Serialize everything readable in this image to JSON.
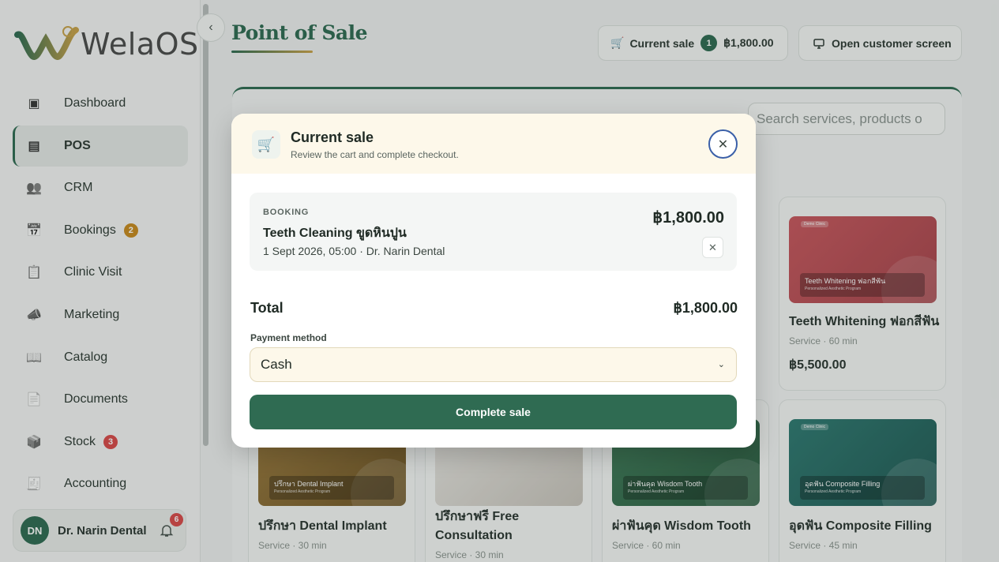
{
  "app": {
    "name": "WelaOS"
  },
  "sidebar": {
    "items": [
      {
        "label": "Dashboard",
        "icon": "dashboard-icon"
      },
      {
        "label": "POS",
        "icon": "pos-register-icon",
        "active": true
      },
      {
        "label": "CRM",
        "icon": "users-icon"
      },
      {
        "label": "Bookings",
        "icon": "calendar-check-icon",
        "badge": "2",
        "badge_color": "#c98a1f"
      },
      {
        "label": "Clinic Visit",
        "icon": "clipboard-icon"
      },
      {
        "label": "Marketing",
        "icon": "megaphone-icon"
      },
      {
        "label": "Catalog",
        "icon": "book-icon"
      },
      {
        "label": "Documents",
        "icon": "document-icon"
      },
      {
        "label": "Stock",
        "icon": "box-icon",
        "badge": "3",
        "badge_color": "#d94a4a"
      },
      {
        "label": "Accounting",
        "icon": "accounting-icon"
      }
    ],
    "user": {
      "initials": "DN",
      "name": "Dr. Narin Dental",
      "notifications": "6"
    }
  },
  "header": {
    "title": "Point of Sale",
    "current_sale_label": "Current sale",
    "current_sale_count": "1",
    "current_sale_total": "฿1,800.00",
    "open_customer_screen_label": "Open customer screen"
  },
  "search": {
    "placeholder": "Search services, products o"
  },
  "services": [
    {
      "name": "Teeth Whitening ฟอกสีฟัน",
      "meta": "Service · 60 min",
      "price": "฿5,500.00",
      "image_label": "Teeth Whitening ฟอกสีฟัน",
      "image_sub": "Personalized Aesthetic Program",
      "chip": "Demo Clinic"
    },
    {
      "name": "ปรึกษา Dental Implant",
      "meta": "Service · 30 min",
      "image_label": "ปรึกษา Dental Implant",
      "image_sub": "Personalized Aesthetic Program"
    },
    {
      "name": "ปรึกษาฟรี Free Consultation",
      "meta": "Service · 30 min"
    },
    {
      "name": "ผ่าฟันคุด Wisdom Tooth",
      "meta": "Service · 60 min",
      "image_label": "ผ่าฟันคุด Wisdom Tooth",
      "image_sub": "Personalized Aesthetic Program"
    },
    {
      "name": "อุดฟัน Composite Filling",
      "meta": "Service · 45 min",
      "image_label": "อุดฟัน Composite Filling",
      "image_sub": "Personalized Aesthetic Program",
      "chip": "Demo Clinic"
    }
  ],
  "modal": {
    "title": "Current sale",
    "subtitle": "Review the cart and complete checkout.",
    "item": {
      "type": "BOOKING",
      "name": "Teeth Cleaning ขูดหินปูน",
      "when": "1 Sept 2026, 05:00 · Dr. Narin Dental",
      "price": "฿1,800.00"
    },
    "total_label": "Total",
    "total_value": "฿1,800.00",
    "payment_label": "Payment method",
    "payment_value": "Cash",
    "complete_label": "Complete sale"
  },
  "colors": {
    "brand": "#2f6b52",
    "accent_gold": "#c9a24a",
    "modal_header_bg": "#fdf8ea"
  }
}
